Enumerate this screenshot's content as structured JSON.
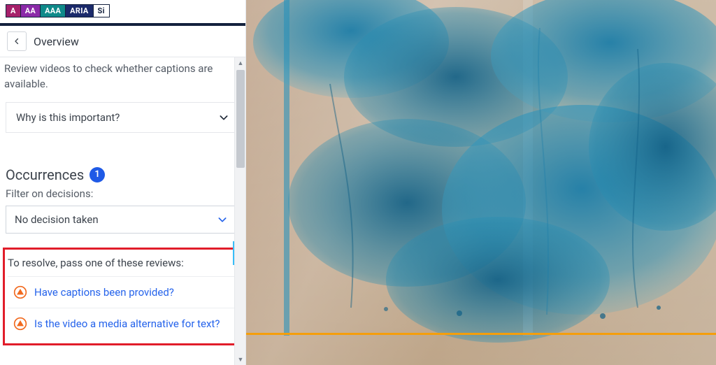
{
  "badges": {
    "a": "A",
    "aa": "AA",
    "aaa": "AAA",
    "aria": "ARIA",
    "si": "Si"
  },
  "header": {
    "overview_label": "Overview"
  },
  "description": "Review videos to check whether captions are available.",
  "accordion": {
    "why_label": "Why is this important?"
  },
  "occurrences": {
    "title": "Occurrences",
    "count": "1",
    "filter_label": "Filter on decisions:",
    "filter_value": "No decision taken"
  },
  "resolve": {
    "title": "To resolve, pass one of these reviews:",
    "items": [
      {
        "label": "Have captions been provided?"
      },
      {
        "label": "Is the video a media alternative for text?"
      }
    ]
  }
}
